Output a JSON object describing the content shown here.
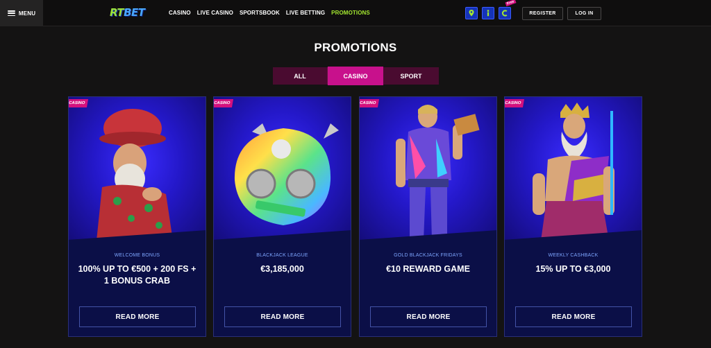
{
  "header": {
    "menu_label": "MENU",
    "logo_part1": "RT",
    "logo_part2": "BET",
    "nav": [
      {
        "label": "CASINO",
        "active": false
      },
      {
        "label": "LIVE CASINO",
        "active": false
      },
      {
        "label": "SPORTSBOOK",
        "active": false
      },
      {
        "label": "LIVE BETTING",
        "active": false
      },
      {
        "label": "PROMOTIONS",
        "active": true
      }
    ],
    "icons": [
      "map-pin-icon",
      "info-icon",
      "coin-icon"
    ],
    "free_tag": "Free",
    "register_label": "REGISTER",
    "login_label": "LOG IN"
  },
  "page": {
    "title": "PROMOTIONS",
    "tabs": [
      {
        "label": "ALL",
        "active": false
      },
      {
        "label": "CASINO",
        "active": true
      },
      {
        "label": "SPORT",
        "active": false
      }
    ]
  },
  "cards": [
    {
      "badge": "CASINO",
      "subtitle": "WELCOME BONUS",
      "title": "100% UP TO €500 + 200 FS + 1 BONUS CRAB",
      "button": "READ MORE",
      "art": "gnome-character"
    },
    {
      "badge": "CASINO",
      "subtitle": "BLACKJACK LEAGUE",
      "title": "€3,185,000",
      "button": "READ MORE",
      "art": "mega-win-helmet"
    },
    {
      "badge": "CASINO",
      "subtitle": "GOLD BLACKJACK FRIDAYS",
      "title": "€10 REWARD GAME",
      "button": "READ MORE",
      "art": "card-dealer-character"
    },
    {
      "badge": "CASINO",
      "subtitle": "WEEKLY CASHBACK",
      "title": "15% UP TO €3,000",
      "button": "READ MORE",
      "art": "zeus-character"
    }
  ],
  "colors": {
    "accent_green": "#a4e830",
    "accent_pink": "#c8118c",
    "card_bg": "#0b0f47",
    "icon_blue": "#1533b8"
  }
}
